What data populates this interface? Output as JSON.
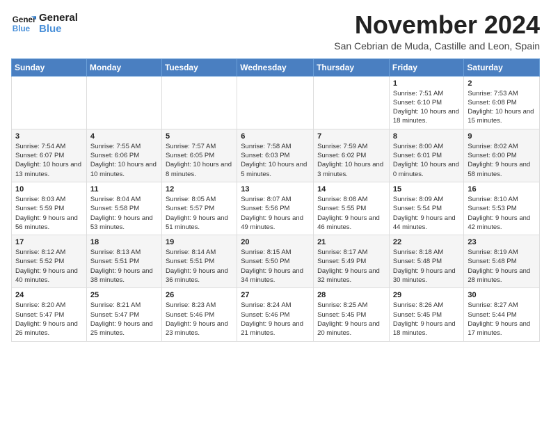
{
  "logo": {
    "line1": "General",
    "line2": "Blue"
  },
  "title": "November 2024",
  "subtitle": "San Cebrian de Muda, Castille and Leon, Spain",
  "weekdays": [
    "Sunday",
    "Monday",
    "Tuesday",
    "Wednesday",
    "Thursday",
    "Friday",
    "Saturday"
  ],
  "weeks": [
    [
      {
        "day": "",
        "info": ""
      },
      {
        "day": "",
        "info": ""
      },
      {
        "day": "",
        "info": ""
      },
      {
        "day": "",
        "info": ""
      },
      {
        "day": "",
        "info": ""
      },
      {
        "day": "1",
        "info": "Sunrise: 7:51 AM\nSunset: 6:10 PM\nDaylight: 10 hours and 18 minutes."
      },
      {
        "day": "2",
        "info": "Sunrise: 7:53 AM\nSunset: 6:08 PM\nDaylight: 10 hours and 15 minutes."
      }
    ],
    [
      {
        "day": "3",
        "info": "Sunrise: 7:54 AM\nSunset: 6:07 PM\nDaylight: 10 hours and 13 minutes."
      },
      {
        "day": "4",
        "info": "Sunrise: 7:55 AM\nSunset: 6:06 PM\nDaylight: 10 hours and 10 minutes."
      },
      {
        "day": "5",
        "info": "Sunrise: 7:57 AM\nSunset: 6:05 PM\nDaylight: 10 hours and 8 minutes."
      },
      {
        "day": "6",
        "info": "Sunrise: 7:58 AM\nSunset: 6:03 PM\nDaylight: 10 hours and 5 minutes."
      },
      {
        "day": "7",
        "info": "Sunrise: 7:59 AM\nSunset: 6:02 PM\nDaylight: 10 hours and 3 minutes."
      },
      {
        "day": "8",
        "info": "Sunrise: 8:00 AM\nSunset: 6:01 PM\nDaylight: 10 hours and 0 minutes."
      },
      {
        "day": "9",
        "info": "Sunrise: 8:02 AM\nSunset: 6:00 PM\nDaylight: 9 hours and 58 minutes."
      }
    ],
    [
      {
        "day": "10",
        "info": "Sunrise: 8:03 AM\nSunset: 5:59 PM\nDaylight: 9 hours and 56 minutes."
      },
      {
        "day": "11",
        "info": "Sunrise: 8:04 AM\nSunset: 5:58 PM\nDaylight: 9 hours and 53 minutes."
      },
      {
        "day": "12",
        "info": "Sunrise: 8:05 AM\nSunset: 5:57 PM\nDaylight: 9 hours and 51 minutes."
      },
      {
        "day": "13",
        "info": "Sunrise: 8:07 AM\nSunset: 5:56 PM\nDaylight: 9 hours and 49 minutes."
      },
      {
        "day": "14",
        "info": "Sunrise: 8:08 AM\nSunset: 5:55 PM\nDaylight: 9 hours and 46 minutes."
      },
      {
        "day": "15",
        "info": "Sunrise: 8:09 AM\nSunset: 5:54 PM\nDaylight: 9 hours and 44 minutes."
      },
      {
        "day": "16",
        "info": "Sunrise: 8:10 AM\nSunset: 5:53 PM\nDaylight: 9 hours and 42 minutes."
      }
    ],
    [
      {
        "day": "17",
        "info": "Sunrise: 8:12 AM\nSunset: 5:52 PM\nDaylight: 9 hours and 40 minutes."
      },
      {
        "day": "18",
        "info": "Sunrise: 8:13 AM\nSunset: 5:51 PM\nDaylight: 9 hours and 38 minutes."
      },
      {
        "day": "19",
        "info": "Sunrise: 8:14 AM\nSunset: 5:51 PM\nDaylight: 9 hours and 36 minutes."
      },
      {
        "day": "20",
        "info": "Sunrise: 8:15 AM\nSunset: 5:50 PM\nDaylight: 9 hours and 34 minutes."
      },
      {
        "day": "21",
        "info": "Sunrise: 8:17 AM\nSunset: 5:49 PM\nDaylight: 9 hours and 32 minutes."
      },
      {
        "day": "22",
        "info": "Sunrise: 8:18 AM\nSunset: 5:48 PM\nDaylight: 9 hours and 30 minutes."
      },
      {
        "day": "23",
        "info": "Sunrise: 8:19 AM\nSunset: 5:48 PM\nDaylight: 9 hours and 28 minutes."
      }
    ],
    [
      {
        "day": "24",
        "info": "Sunrise: 8:20 AM\nSunset: 5:47 PM\nDaylight: 9 hours and 26 minutes."
      },
      {
        "day": "25",
        "info": "Sunrise: 8:21 AM\nSunset: 5:47 PM\nDaylight: 9 hours and 25 minutes."
      },
      {
        "day": "26",
        "info": "Sunrise: 8:23 AM\nSunset: 5:46 PM\nDaylight: 9 hours and 23 minutes."
      },
      {
        "day": "27",
        "info": "Sunrise: 8:24 AM\nSunset: 5:46 PM\nDaylight: 9 hours and 21 minutes."
      },
      {
        "day": "28",
        "info": "Sunrise: 8:25 AM\nSunset: 5:45 PM\nDaylight: 9 hours and 20 minutes."
      },
      {
        "day": "29",
        "info": "Sunrise: 8:26 AM\nSunset: 5:45 PM\nDaylight: 9 hours and 18 minutes."
      },
      {
        "day": "30",
        "info": "Sunrise: 8:27 AM\nSunset: 5:44 PM\nDaylight: 9 hours and 17 minutes."
      }
    ]
  ]
}
